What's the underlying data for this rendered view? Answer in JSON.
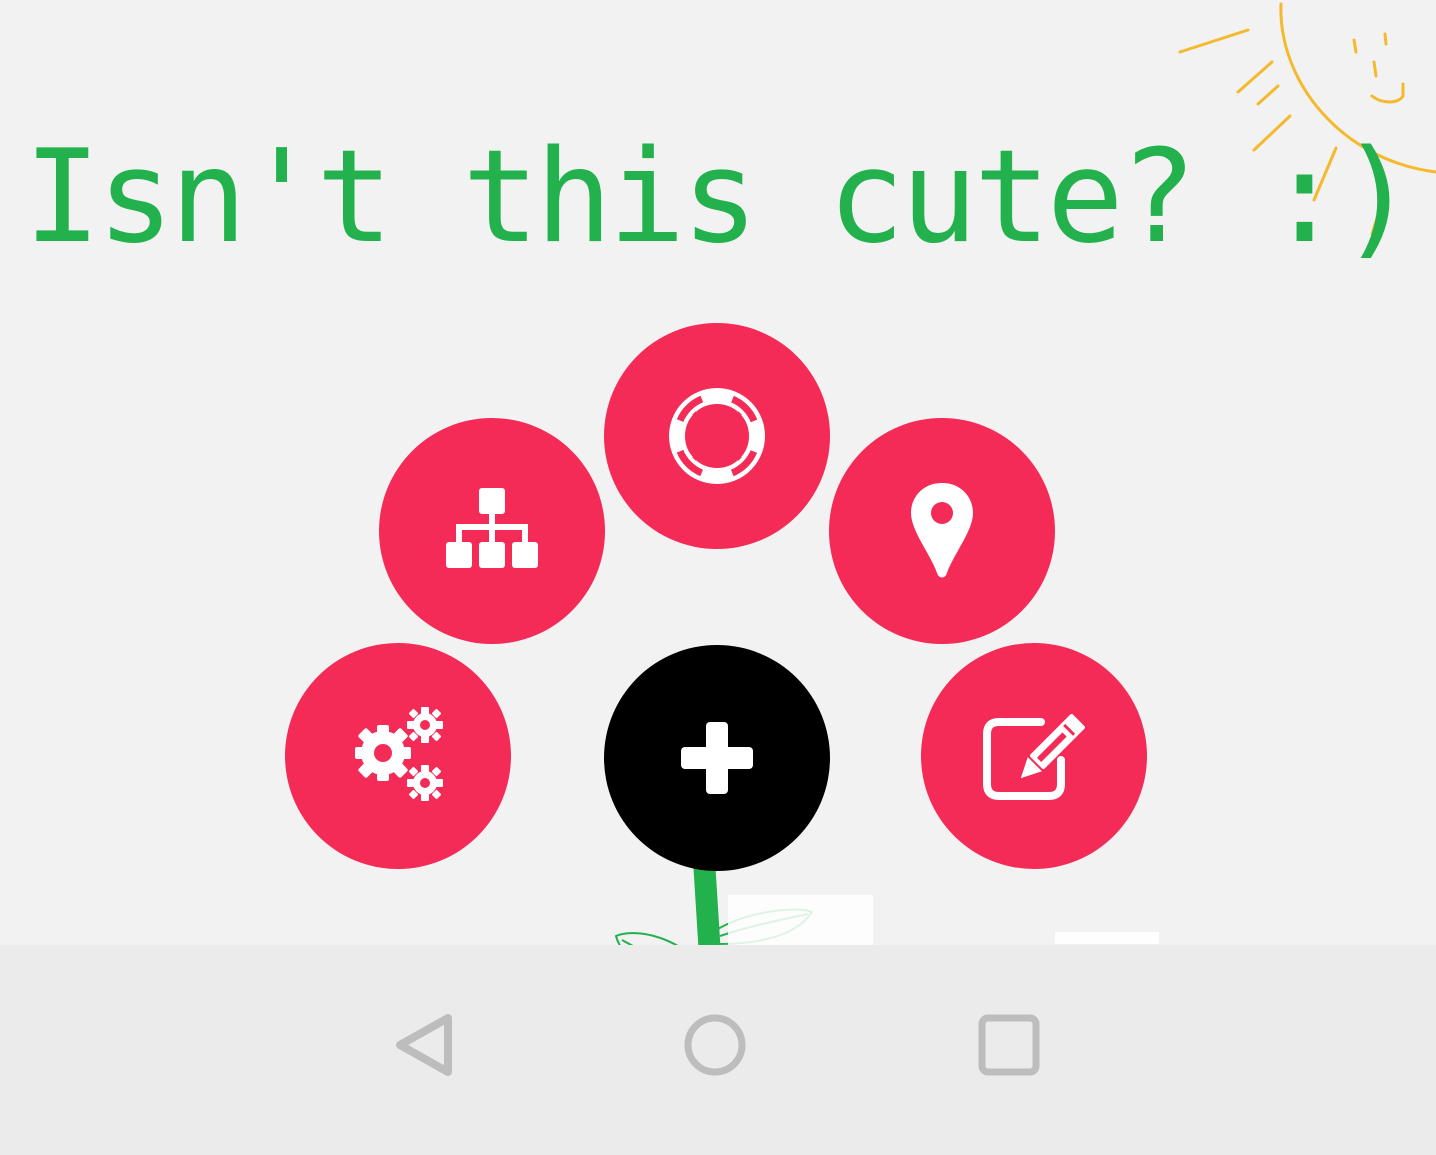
{
  "headline": {
    "text": "Isn't this cute? :)",
    "color": "#22b14c"
  },
  "menu": {
    "accent_color": "#f42b57",
    "main_button_color": "#000000",
    "main_button_icon": "plus-icon",
    "items": [
      {
        "icon": "gears-icon"
      },
      {
        "icon": "sitemap-icon"
      },
      {
        "icon": "life-ring-icon"
      },
      {
        "icon": "map-marker-icon"
      },
      {
        "icon": "edit-icon"
      }
    ]
  },
  "navbar": {
    "background": "#ebebeb",
    "icon_color": "#bdbdbd",
    "buttons": [
      {
        "icon": "back-triangle-icon"
      },
      {
        "icon": "home-circle-icon"
      },
      {
        "icon": "recents-square-icon"
      }
    ]
  },
  "doodles": {
    "sun_color": "#f5b92e",
    "stem_color": "#22b14c"
  }
}
